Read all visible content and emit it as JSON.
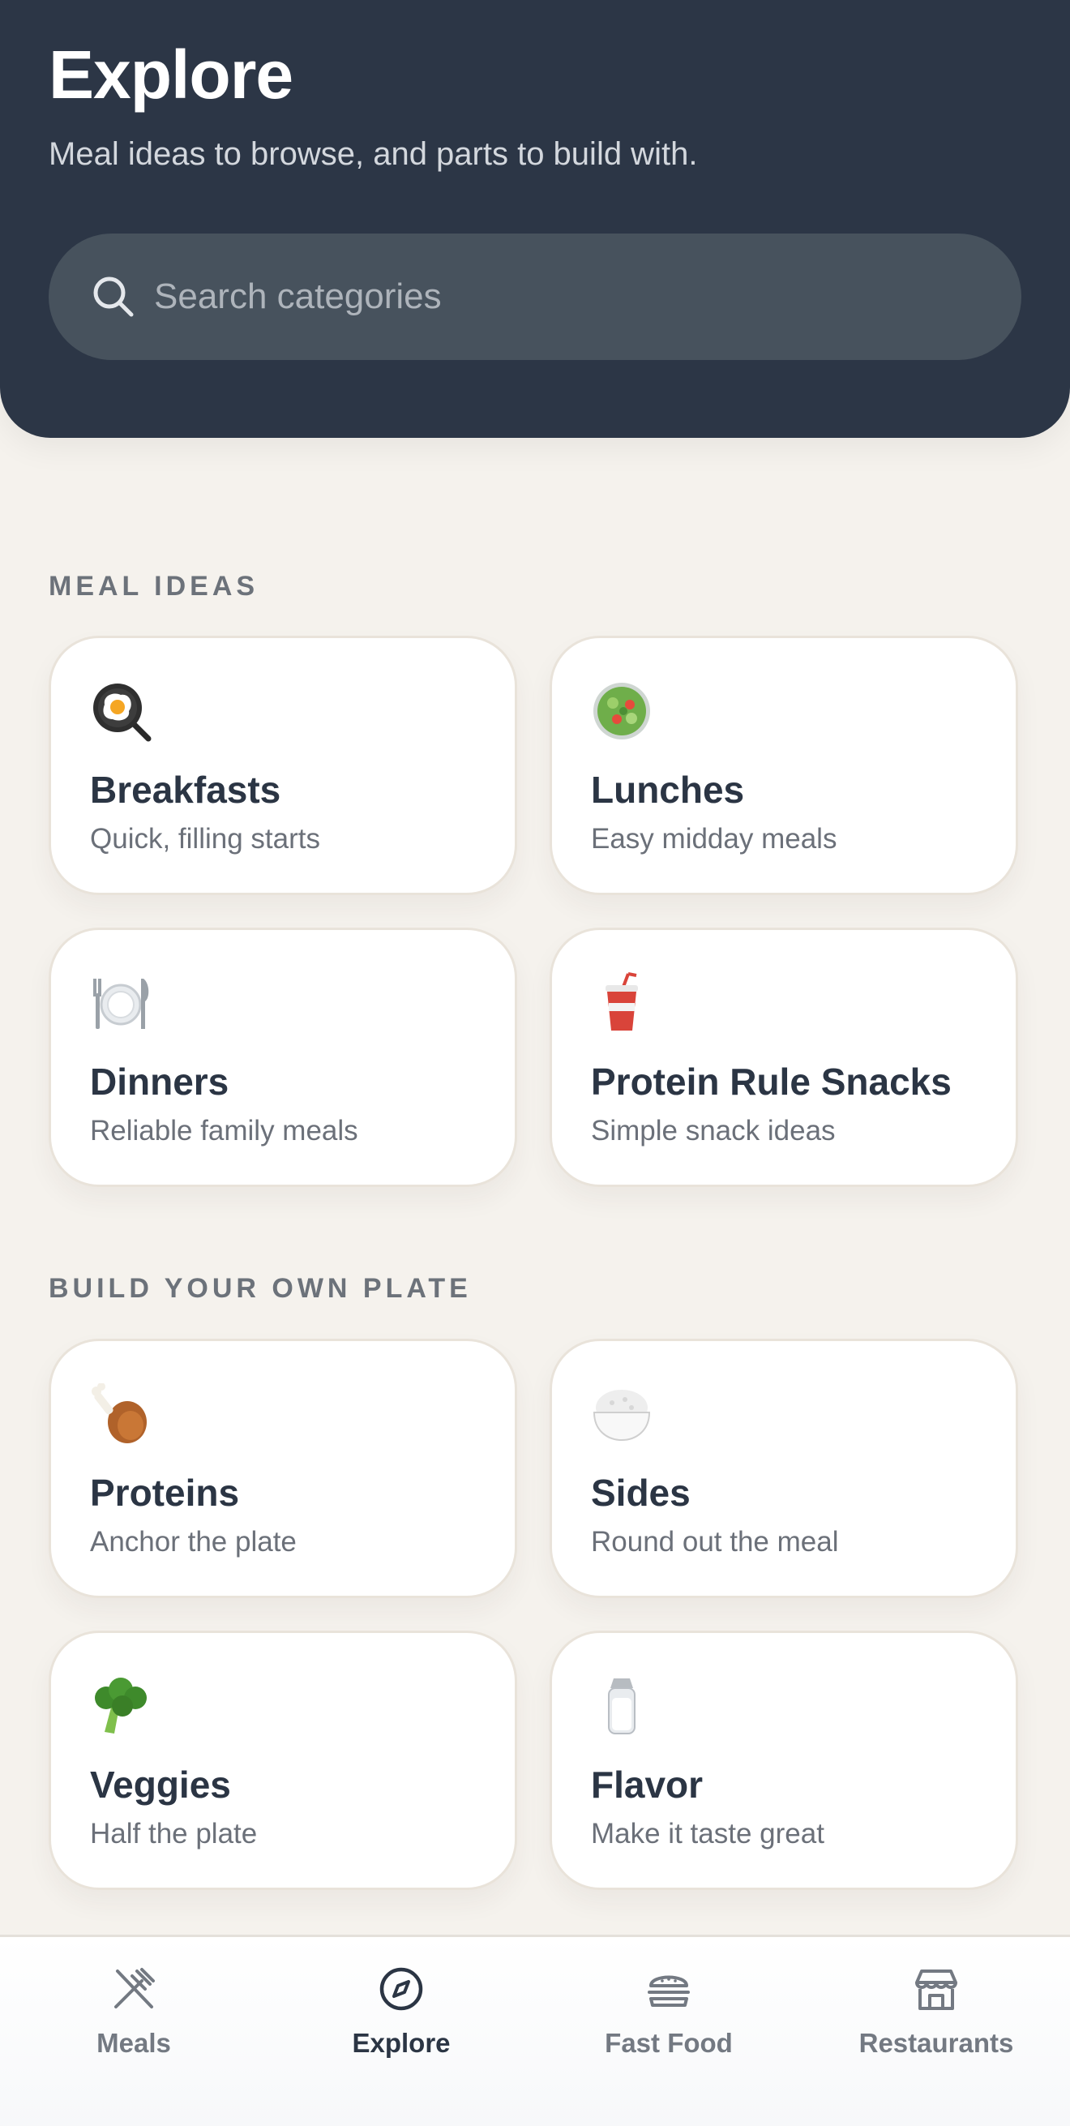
{
  "header": {
    "title": "Explore",
    "subtitle": "Meal ideas to browse, and parts to build with."
  },
  "search": {
    "placeholder": "Search categories",
    "value": ""
  },
  "sections": {
    "meal_ideas": {
      "label": "MEAL IDEAS",
      "cards": [
        {
          "title": "Breakfasts",
          "desc": "Quick, filling starts",
          "icon": "frying-pan-egg-icon"
        },
        {
          "title": "Lunches",
          "desc": "Easy midday meals",
          "icon": "salad-bowl-icon"
        },
        {
          "title": "Dinners",
          "desc": "Reliable family meals",
          "icon": "plate-fork-knife-icon"
        },
        {
          "title": "Protein Rule Snacks",
          "desc": "Simple snack ideas",
          "icon": "cup-with-straw-icon"
        }
      ]
    },
    "build_plate": {
      "label": "BUILD YOUR OWN PLATE",
      "cards": [
        {
          "title": "Proteins",
          "desc": "Anchor the plate",
          "icon": "chicken-leg-icon"
        },
        {
          "title": "Sides",
          "desc": "Round out the meal",
          "icon": "rice-bowl-icon"
        },
        {
          "title": "Veggies",
          "desc": "Half the plate",
          "icon": "broccoli-icon"
        },
        {
          "title": "Flavor",
          "desc": "Make it taste great",
          "icon": "salt-shaker-icon"
        }
      ]
    }
  },
  "nav": {
    "items": [
      {
        "label": "Meals",
        "icon": "fork-knife-icon"
      },
      {
        "label": "Explore",
        "icon": "compass-icon",
        "active": true
      },
      {
        "label": "Fast Food",
        "icon": "burger-icon"
      },
      {
        "label": "Restaurants",
        "icon": "storefront-icon"
      }
    ]
  },
  "colors": {
    "header_bg": "#2c3646",
    "page_bg": "#f5f2ed",
    "search_bg": "#47525d",
    "text_dark": "#2b3544",
    "text_muted": "#6b7079"
  }
}
